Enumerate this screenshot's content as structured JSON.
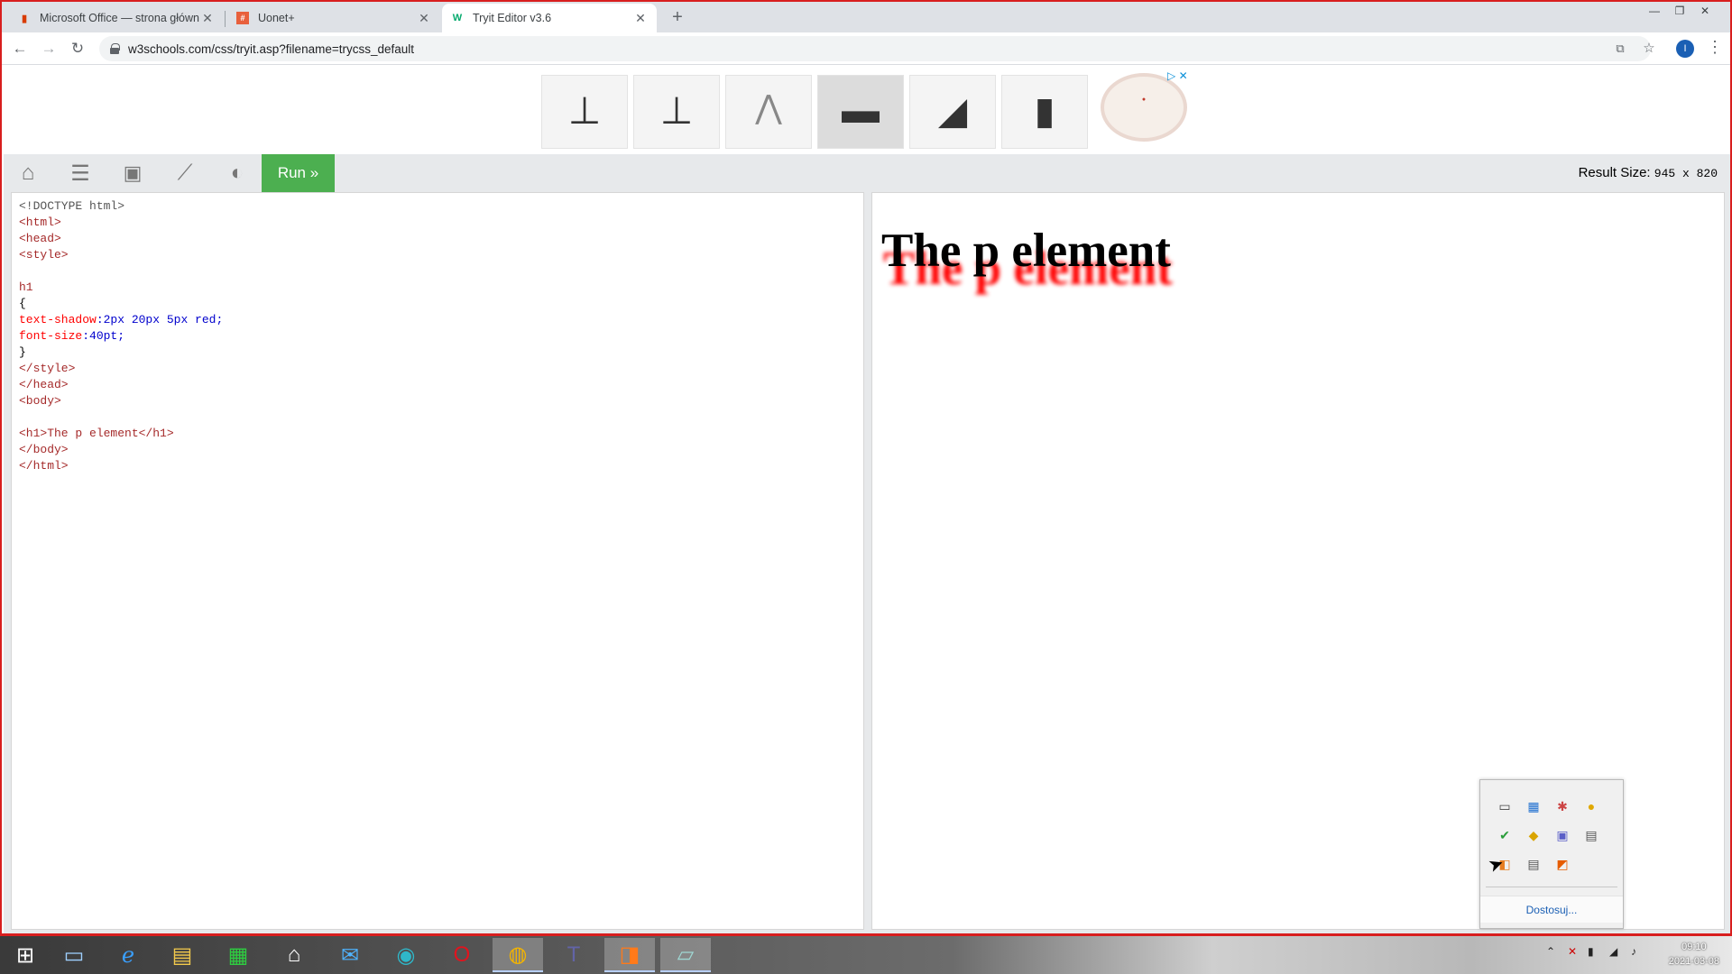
{
  "browser": {
    "tabs": [
      {
        "title": "Microsoft Office — strona główn",
        "favicon": "office-icon",
        "active": false
      },
      {
        "title": "Uonet+",
        "favicon": "uonet-icon",
        "active": false
      },
      {
        "title": "Tryit Editor v3.6",
        "favicon": "w3schools-icon",
        "active": true
      }
    ],
    "url": "w3schools.com/css/tryit.asp?filename=trycss_default",
    "profile_initial": "I"
  },
  "tryit": {
    "run_label": "Run »",
    "result_size_label": "Result Size:",
    "result_size_value": "945 x 820",
    "toolbar_icons": [
      "home-icon",
      "menu-icon",
      "save-icon",
      "rotate-icon",
      "contrast-icon"
    ]
  },
  "code": {
    "lines": [
      "<!DOCTYPE html>",
      "<html>",
      "<head>",
      "<style>",
      "",
      "h1",
      "{",
      "text-shadow:2px 20px 5px red;",
      "font-size:40pt;",
      "}",
      "</style>",
      "</head>",
      "<body>",
      "",
      "<h1>The p element</h1>",
      "</body>",
      "</html>"
    ]
  },
  "result": {
    "h1_text": "The p element"
  },
  "tray": {
    "customize_label": "Dostosuj..."
  },
  "clock": {
    "time": "09:10",
    "date": "2021-03-08"
  },
  "colors": {
    "run_button": "#4caf50",
    "window_frame": "#d81e1e",
    "shadow": "red"
  }
}
